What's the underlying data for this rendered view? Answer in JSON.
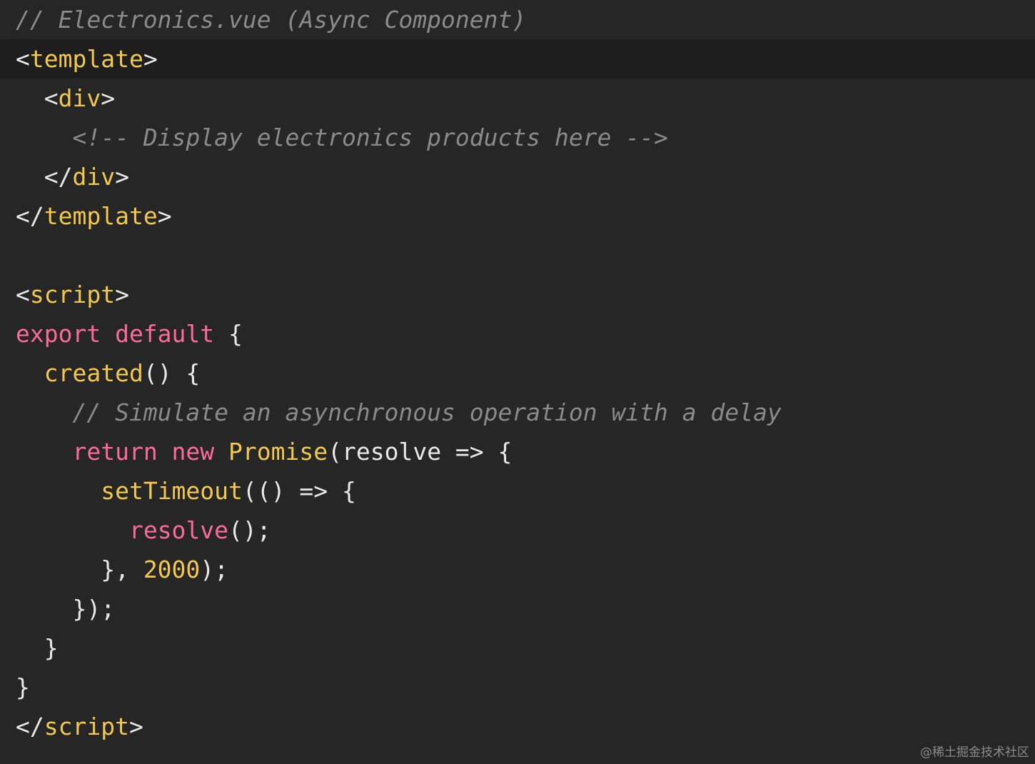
{
  "editor": {
    "colors": {
      "background": "#262626",
      "active_line": "#1e1e1e",
      "default": "#e8e8e8",
      "keyword": "#fc6a9a",
      "function": "#f2c94c",
      "number": "#f2c94c",
      "tag": "#f2c94c",
      "comment": "#8a8a8a"
    },
    "lines": [
      {
        "tokens": [
          {
            "t": "// Electronics.vue (Async Component)",
            "c": "comment",
            "i": true
          }
        ]
      },
      {
        "active": true,
        "tokens": [
          {
            "t": "<",
            "c": "default"
          },
          {
            "t": "template",
            "c": "tag"
          },
          {
            "t": ">",
            "c": "default"
          }
        ]
      },
      {
        "tokens": [
          {
            "t": "  <",
            "c": "default"
          },
          {
            "t": "div",
            "c": "tag"
          },
          {
            "t": ">",
            "c": "default"
          }
        ]
      },
      {
        "tokens": [
          {
            "t": "    <!-- Display electronics products here -->",
            "c": "comment",
            "i": true
          }
        ]
      },
      {
        "tokens": [
          {
            "t": "  </",
            "c": "default"
          },
          {
            "t": "div",
            "c": "tag"
          },
          {
            "t": ">",
            "c": "default"
          }
        ]
      },
      {
        "tokens": [
          {
            "t": "</",
            "c": "default"
          },
          {
            "t": "template",
            "c": "tag"
          },
          {
            "t": ">",
            "c": "default"
          }
        ]
      },
      {
        "tokens": []
      },
      {
        "tokens": [
          {
            "t": "<",
            "c": "default"
          },
          {
            "t": "script",
            "c": "tag"
          },
          {
            "t": ">",
            "c": "default"
          }
        ]
      },
      {
        "tokens": [
          {
            "t": "export default",
            "c": "keyword"
          },
          {
            "t": " {",
            "c": "default"
          }
        ]
      },
      {
        "tokens": [
          {
            "t": "  ",
            "c": "default"
          },
          {
            "t": "created",
            "c": "function"
          },
          {
            "t": "() {",
            "c": "default"
          }
        ]
      },
      {
        "tokens": [
          {
            "t": "    // Simulate an asynchronous operation with a delay",
            "c": "comment",
            "i": true
          }
        ]
      },
      {
        "tokens": [
          {
            "t": "    ",
            "c": "default"
          },
          {
            "t": "return new",
            "c": "keyword"
          },
          {
            "t": " ",
            "c": "default"
          },
          {
            "t": "Promise",
            "c": "function"
          },
          {
            "t": "(resolve => {",
            "c": "default"
          }
        ]
      },
      {
        "tokens": [
          {
            "t": "      ",
            "c": "default"
          },
          {
            "t": "setTimeout",
            "c": "function"
          },
          {
            "t": "(() => {",
            "c": "default"
          }
        ]
      },
      {
        "tokens": [
          {
            "t": "        ",
            "c": "default"
          },
          {
            "t": "resolve",
            "c": "keyword"
          },
          {
            "t": "();",
            "c": "default"
          }
        ]
      },
      {
        "tokens": [
          {
            "t": "      }, ",
            "c": "default"
          },
          {
            "t": "2000",
            "c": "number"
          },
          {
            "t": ");",
            "c": "default"
          }
        ]
      },
      {
        "tokens": [
          {
            "t": "    });",
            "c": "default"
          }
        ]
      },
      {
        "tokens": [
          {
            "t": "  }",
            "c": "default"
          }
        ]
      },
      {
        "tokens": [
          {
            "t": "}",
            "c": "default"
          }
        ]
      },
      {
        "tokens": [
          {
            "t": "</",
            "c": "default"
          },
          {
            "t": "script",
            "c": "tag"
          },
          {
            "t": ">",
            "c": "default"
          }
        ]
      }
    ]
  },
  "watermark": "@稀土掘金技术社区"
}
